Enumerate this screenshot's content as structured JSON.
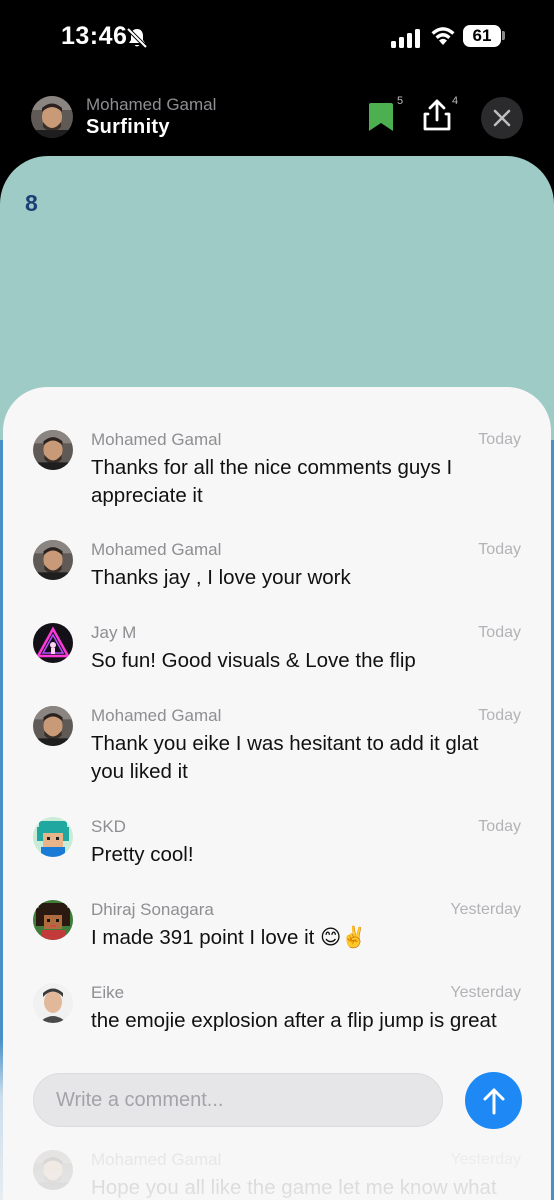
{
  "status_bar": {
    "time": "13:46",
    "battery": "61"
  },
  "header": {
    "author": "Mohamed Gamal",
    "title": "Surfinity",
    "bookmark_count": "5",
    "share_count": "4"
  },
  "game": {
    "score": "8"
  },
  "comments": [
    {
      "author": "Mohamed Gamal",
      "time": "Today",
      "text": "Thanks for all the nice comments guys I appreciate it",
      "avatar": "photo-man"
    },
    {
      "author": "Mohamed Gamal",
      "time": "Today",
      "text": "Thanks jay , I love your work",
      "avatar": "photo-man"
    },
    {
      "author": "Jay M",
      "time": "Today",
      "text": "So fun! Good visuals & Love the flip",
      "avatar": "neon-triangle"
    },
    {
      "author": "Mohamed Gamal",
      "time": "Today",
      "text": "Thank you eike I was hesitant to add it glat you liked it",
      "avatar": "photo-man"
    },
    {
      "author": "SKD",
      "time": "Today",
      "text": "Pretty cool!",
      "avatar": "pixel-teal-hair"
    },
    {
      "author": "Dhiraj Sonagara",
      "time": "Yesterday",
      "text": "I made 391 point I love it 😊✌️",
      "avatar": "pixel-dark-hair"
    },
    {
      "author": "Eike",
      "time": "Yesterday",
      "text": "the emojie explosion after a flip jump is great",
      "avatar": "photo-eike"
    },
    {
      "author": "Mohamed Gamal",
      "time": "Yesterday",
      "text": "Hope you all like the game let me know what",
      "avatar": "photo-man"
    }
  ],
  "comment_input": {
    "placeholder": "Write a comment..."
  },
  "colors": {
    "game_bg": "#9fcbc6",
    "score": "#1d3f78",
    "send_button": "#1e88f5",
    "bookmark": "#4caf50"
  }
}
